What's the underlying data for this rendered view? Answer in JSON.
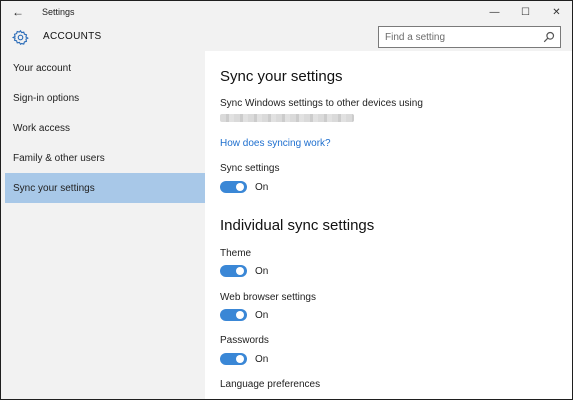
{
  "window": {
    "title": "Settings",
    "back_glyph": "←",
    "minimize_glyph": "—",
    "maximize_glyph": "☐",
    "close_glyph": "✕"
  },
  "header": {
    "title": "ACCOUNTS",
    "icon": "gear-icon"
  },
  "search": {
    "placeholder": "Find a setting",
    "icon": "search-icon"
  },
  "sidebar": {
    "items": [
      {
        "label": "Your account",
        "selected": false
      },
      {
        "label": "Sign-in options",
        "selected": false
      },
      {
        "label": "Work access",
        "selected": false
      },
      {
        "label": "Family & other users",
        "selected": false
      },
      {
        "label": "Sync your settings",
        "selected": true
      }
    ]
  },
  "main": {
    "heading": "Sync your settings",
    "description": "Sync Windows settings to other devices using",
    "link": "How does syncing work?",
    "sync_settings": {
      "label": "Sync settings",
      "state": "On"
    },
    "individual_heading": "Individual sync settings",
    "theme": {
      "label": "Theme",
      "state": "On"
    },
    "browser": {
      "label": "Web browser settings",
      "state": "On"
    },
    "passwords": {
      "label": "Passwords",
      "state": "On"
    },
    "language": {
      "label": "Language preferences"
    }
  },
  "colors": {
    "accent": "#3a87d6",
    "selected_nav": "#a8c8e8",
    "link": "#1e6fcf",
    "chrome": "#f2f2f2"
  }
}
